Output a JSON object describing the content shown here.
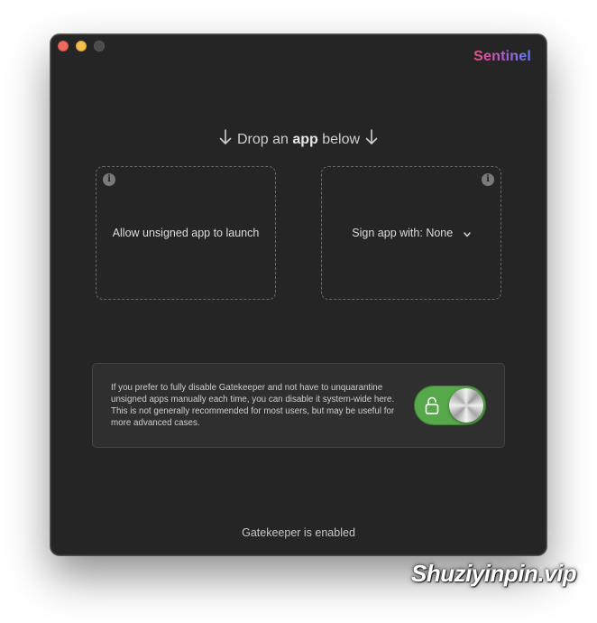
{
  "window": {
    "controls": {
      "close_icon": "traffic-light-close",
      "minimize_icon": "traffic-light-minimize",
      "zoom_icon": "traffic-light-zoom"
    },
    "brand": "Sentinel",
    "brand_gradient": [
      "#ef4f7c",
      "#b55cd2",
      "#5f7ef2"
    ]
  },
  "drop": {
    "heading_prefix": "Drop an",
    "heading_bold": "app",
    "heading_suffix": "below",
    "arrow_icon": "arrow-down-icon"
  },
  "zones": {
    "unsigned": {
      "label": "Allow unsigned app to launch",
      "info_icon": "i"
    },
    "sign": {
      "label_prefix": "Sign app with:",
      "selected": "None",
      "info_icon": "i"
    }
  },
  "gatekeeper": {
    "description": "If you prefer to fully disable Gatekeeper and not have to unquarantine unsigned apps manually each time, you can disable it system-wide here. This is not generally recommended for most users, but may be useful for more advanced cases.",
    "toggle_on": true,
    "toggle_color": "#57a84b",
    "lock_icon": "lock-open-icon"
  },
  "status": {
    "text": "Gatekeeper is enabled"
  },
  "watermark": {
    "text": "Shuziyinpin.vip"
  }
}
